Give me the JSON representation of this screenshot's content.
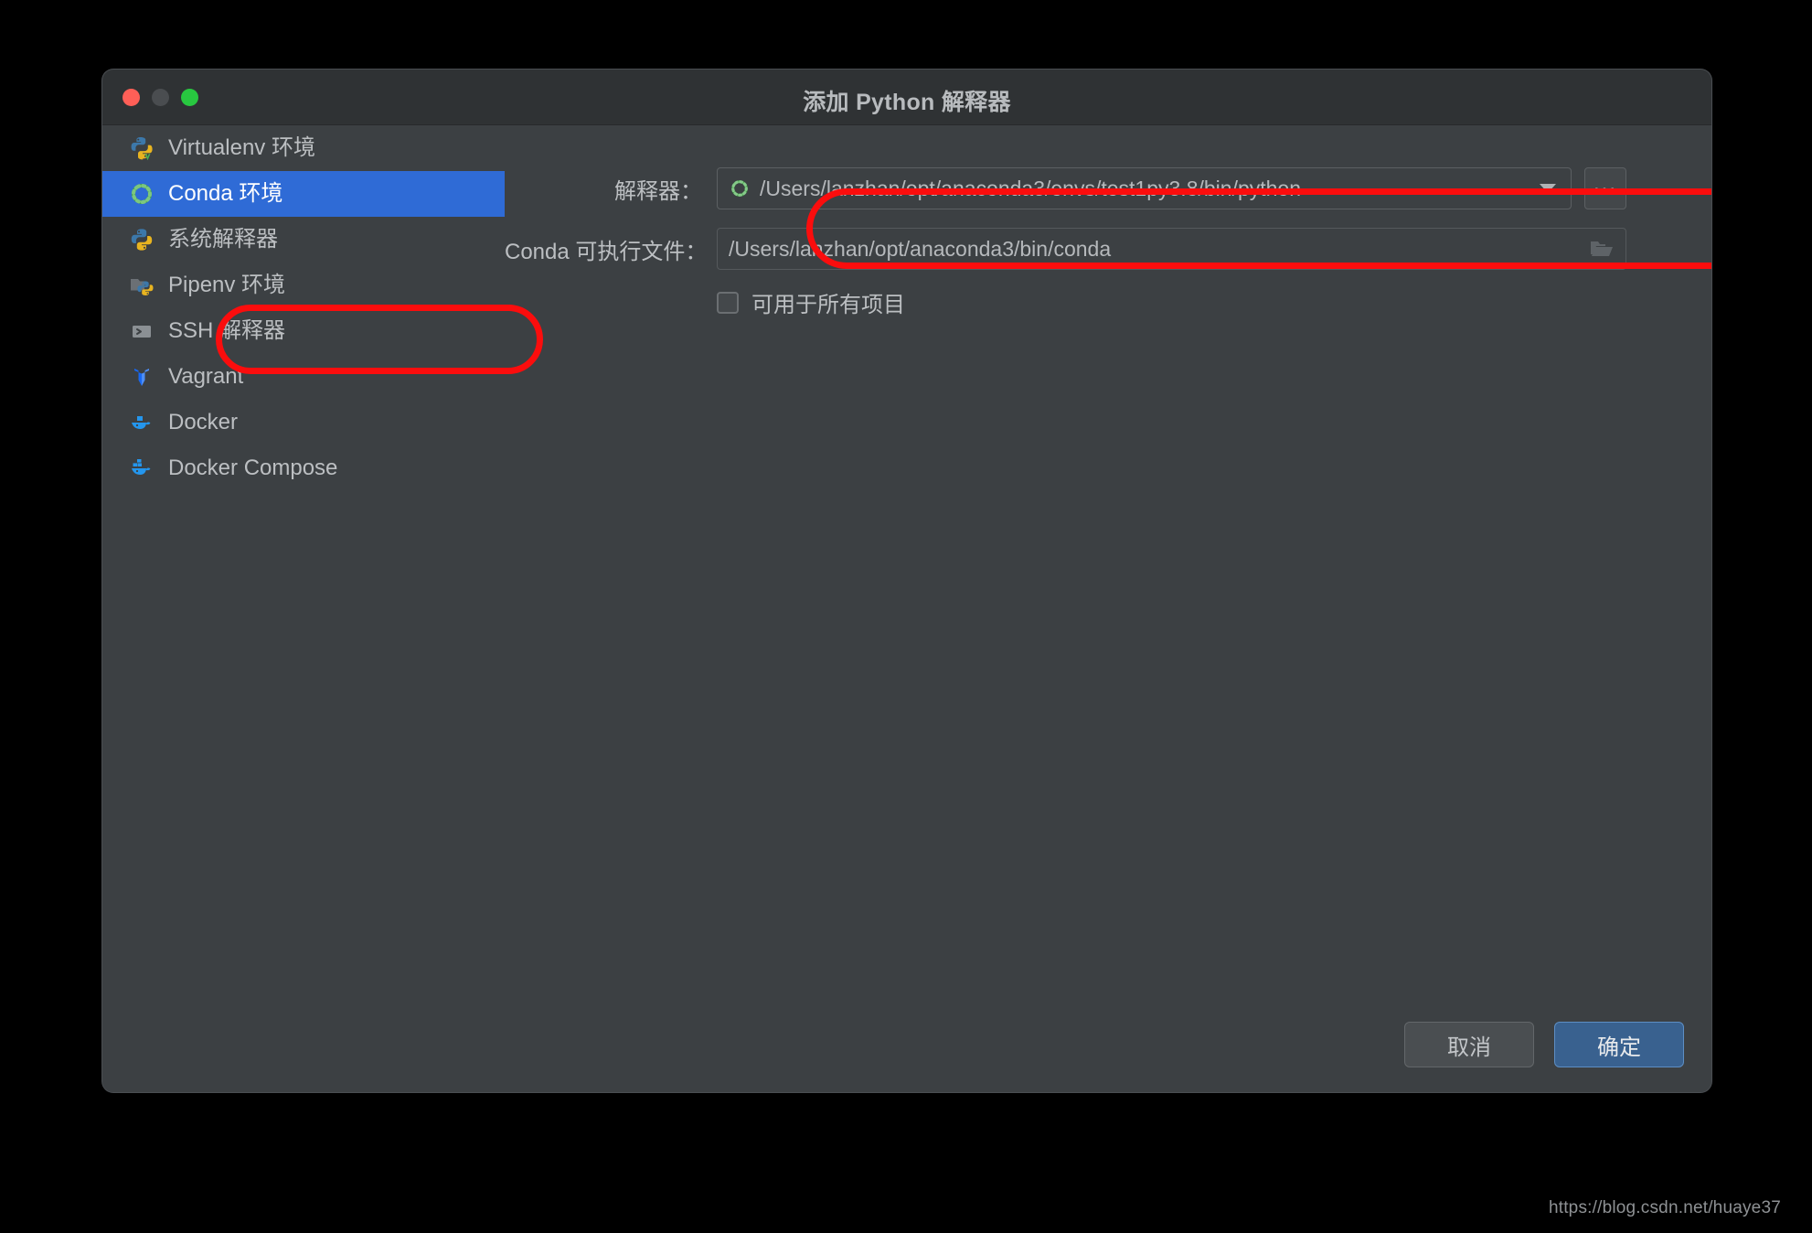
{
  "window": {
    "title": "添加 Python 解释器",
    "controls": {
      "close": "close-button",
      "minimize": "minimize-button",
      "maximize": "maximize-button"
    }
  },
  "sidebar": {
    "items": [
      {
        "label": "Virtualenv 环境",
        "icon": "python-virtualenv-icon",
        "selected": false
      },
      {
        "label": "Conda 环境",
        "icon": "conda-icon",
        "selected": true
      },
      {
        "label": "系统解释器",
        "icon": "python-icon",
        "selected": false
      },
      {
        "label": "Pipenv 环境",
        "icon": "pipenv-folder-python-icon",
        "selected": false
      },
      {
        "label": "SSH 解释器",
        "icon": "ssh-terminal-icon",
        "selected": false
      },
      {
        "label": "Vagrant",
        "icon": "vagrant-icon",
        "selected": false
      },
      {
        "label": "Docker",
        "icon": "docker-whale-icon",
        "selected": false
      },
      {
        "label": "Docker Compose",
        "icon": "docker-compose-whale-icon",
        "selected": false
      }
    ]
  },
  "form": {
    "interpreter": {
      "label": "解释器：",
      "value": "/Users/lanzhan/opt/anaconda3/envs/test1py3.8/bin/python",
      "icon": "conda-icon",
      "dropdown_icon": "chevron-down-icon",
      "browse_label": "..."
    },
    "conda_executable": {
      "label": "Conda 可执行文件：",
      "value": "/Users/lanzhan/opt/anaconda3/bin/conda",
      "browse_icon": "folder-open-icon"
    },
    "available_to_all": {
      "label": "可用于所有项目",
      "checked": false
    }
  },
  "footer": {
    "cancel_label": "取消",
    "ok_label": "确定"
  },
  "annotations": {
    "conda_item_highlight": "red-oval",
    "interpreter_field_highlight": "red-oval"
  },
  "watermark": "https://blog.csdn.net/huaye37",
  "colors": {
    "dialog_bg": "#3c4043",
    "titlebar_bg": "#2f3234",
    "selection_blue": "#2f6bd6",
    "primary_button": "#39618f",
    "annotation_red": "#fb0d0d",
    "conda_green": "#43a047",
    "docker_blue": "#2496ed",
    "vagrant_blue": "#1868f2"
  }
}
